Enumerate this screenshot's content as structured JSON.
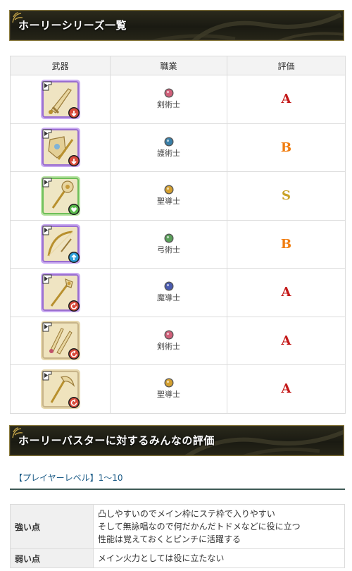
{
  "sections": {
    "series_title": "ホーリーシリーズ一覧",
    "review_title": "ホーリーバスターに対するみんなの評価"
  },
  "weapons_table": {
    "headers": {
      "weapon": "武器",
      "job": "職業",
      "rating": "評価"
    },
    "rows": [
      {
        "weapon_icon": "holy-sword-icon",
        "frame": "purple",
        "badge": "down-arrow",
        "job": "剣術士",
        "job_color": "#d0607a",
        "rating": "A",
        "rating_color": "#c41a1a"
      },
      {
        "weapon_icon": "holy-shield-sword-icon",
        "frame": "purple",
        "badge": "down-arrow",
        "job": "護術士",
        "job_color": "#3a7fa8",
        "rating": "B",
        "rating_color": "#f07d10"
      },
      {
        "weapon_icon": "holy-mace-icon",
        "frame": "green",
        "badge": "heart",
        "job": "聖導士",
        "job_color": "#d4a030",
        "rating": "S",
        "rating_color": "#c9a227"
      },
      {
        "weapon_icon": "holy-bow-icon",
        "frame": "purple",
        "badge": "up-arrow",
        "job": "弓術士",
        "job_color": "#5aa05a",
        "rating": "B",
        "rating_color": "#f07d10"
      },
      {
        "weapon_icon": "holy-staff-icon",
        "frame": "purple",
        "badge": "swirl",
        "job": "魔導士",
        "job_color": "#4a5bb0",
        "rating": "A",
        "rating_color": "#c41a1a"
      },
      {
        "weapon_icon": "holy-twin-blades-icon",
        "frame": "plain",
        "badge": "swirl",
        "job": "剣術士",
        "job_color": "#d0607a",
        "rating": "A",
        "rating_color": "#c41a1a"
      },
      {
        "weapon_icon": "holy-scythe-icon",
        "frame": "plain",
        "badge": "swirl",
        "job": "聖導士",
        "job_color": "#d4a030",
        "rating": "A",
        "rating_color": "#c41a1a"
      }
    ]
  },
  "player_level": "【プレイヤーレベル】1～10",
  "evaluation": {
    "strong_label": "強い点",
    "strong_lines": [
      "凸しやすいのでメイン枠にステ枠で入りやすい",
      "そして無詠唱なので何だかんだトドメなどに役に立つ",
      "性能は覚えておくとピンチに活躍する"
    ],
    "weak_label": "弱い点",
    "weak_text": "メイン火力としては役に立たない"
  }
}
